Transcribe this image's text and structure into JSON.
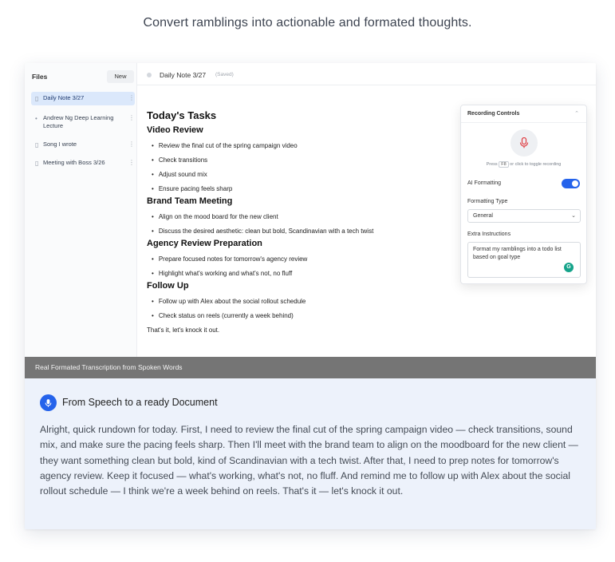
{
  "headline": "Convert ramblings into actionable and formated thoughts.",
  "sidebar": {
    "title": "Files",
    "new_label": "New",
    "files": [
      {
        "label": "Daily Note 3/27",
        "icon": "document-icon",
        "active": true
      },
      {
        "label": "Andrew Ng Deep Learning Lecture",
        "icon": "dot-icon",
        "active": false
      },
      {
        "label": "Song I wrote",
        "icon": "document-icon",
        "active": false
      },
      {
        "label": "Meeting with Boss 3/26",
        "icon": "document-icon",
        "active": false
      }
    ]
  },
  "editor": {
    "tab_title": "Daily Note 3/27",
    "tab_status": "(Saved)",
    "doc": {
      "title": "Today's Tasks",
      "sections": [
        {
          "heading": "Video Review",
          "items": [
            "Review the final cut of the spring campaign video",
            "Check transitions",
            "Adjust sound mix",
            "Ensure pacing feels sharp"
          ]
        },
        {
          "heading": "Brand Team Meeting",
          "items": [
            "Align on the mood board for the new client",
            "Discuss the desired aesthetic: clean but bold, Scandinavian with a tech twist"
          ]
        },
        {
          "heading": "Agency Review Preparation",
          "items": [
            "Prepare focused notes for tomorrow's agency review",
            "Highlight what's working and what's not, no fluff"
          ]
        },
        {
          "heading": "Follow Up",
          "items": [
            "Follow up with Alex about the social rollout schedule",
            "Check status on reels (currently a week behind)"
          ]
        }
      ],
      "closing": "That's it, let's knock it out."
    }
  },
  "recording": {
    "title": "Recording Controls",
    "hint_prefix": "Press",
    "hint_key": "F8",
    "hint_suffix": "or click to toggle recording",
    "ai_formatting_label": "AI Formatting",
    "ai_formatting_on": true,
    "formatting_type_label": "Formatting Type",
    "formatting_type_value": "General",
    "extra_instructions_label": "Extra Instructions",
    "extra_instructions_value": "Format my ramblings into a todo list based on goal type"
  },
  "caption": "Real Formated Transcription from Spoken Words",
  "transcript": {
    "title": "From Speech to a ready Document",
    "body": "Alright, quick rundown for today. First, I need to review the final cut of the spring campaign video — check transitions, sound mix, and make sure the pacing feels sharp. Then I'll meet with the brand team to align on the moodboard for the new client — they want something clean but bold, kind of Scandinavian with a tech twist. After that, I need to prep notes for tomorrow's agency review. Keep it focused — what's working, what's not, no fluff. And remind me to follow up with Alex about the social rollout schedule — I think we're a week behind on reels. That's it — let's knock it out."
  },
  "colors": {
    "accent": "#2563eb",
    "active_file_bg": "#dbe8fb",
    "caption_bar": "#757575",
    "transcript_bg": "#edf2fb"
  }
}
